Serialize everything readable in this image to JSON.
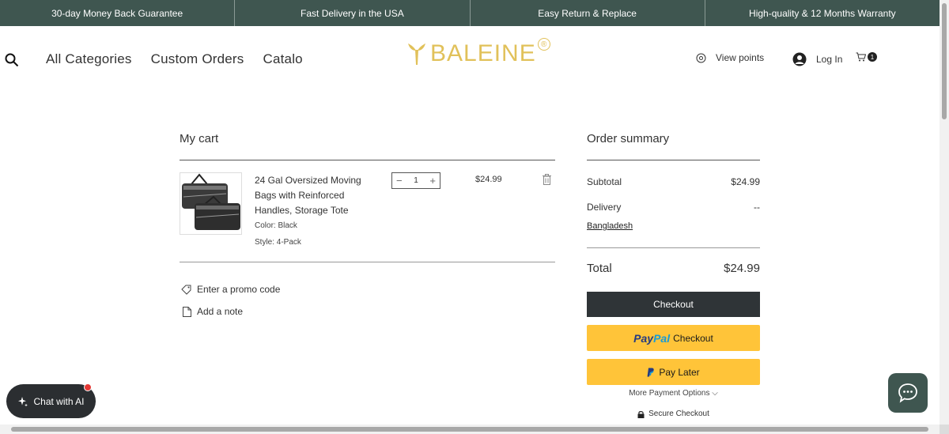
{
  "announcements": [
    "30-day Money Back Guarantee",
    "Fast Delivery in the USA",
    "Easy Return & Replace",
    "High-quality & 12 Months  Warranty"
  ],
  "header": {
    "nav": [
      "All Categories",
      "Custom Orders",
      "Catalo"
    ],
    "logo_text": "BALEINE",
    "logo_mark": "®",
    "view_points": "View points",
    "login": "Log In",
    "cart_count": "1"
  },
  "cart": {
    "title": "My cart",
    "item": {
      "name": "24 Gal Oversized Moving Bags with Reinforced Handles, Storage Tote",
      "color": "Color: Black",
      "style": "Style: 4-Pack",
      "quantity": "1",
      "price": "$24.99"
    },
    "promo_label": "Enter a promo code",
    "note_label": "Add a note"
  },
  "summary": {
    "title": "Order summary",
    "subtotal_label": "Subtotal",
    "subtotal_value": "$24.99",
    "delivery_label": "Delivery",
    "delivery_value": "--",
    "country": "Bangladesh",
    "total_label": "Total",
    "total_value": "$24.99",
    "checkout_label": "Checkout",
    "paypal_brand_1": "Pay",
    "paypal_brand_2": "Pal",
    "paypal_label": "Checkout",
    "paylater_label": "Pay Later",
    "more_payment": "More Payment Options ⌵",
    "secure_checkout": "Secure Checkout"
  },
  "chat_ai_label": "Chat with AI",
  "colors": {
    "brand_green": "#3f5650",
    "logo_gold": "#e1c15a",
    "paypal_yellow": "#ffc439",
    "checkout_dark": "#2f3437"
  }
}
